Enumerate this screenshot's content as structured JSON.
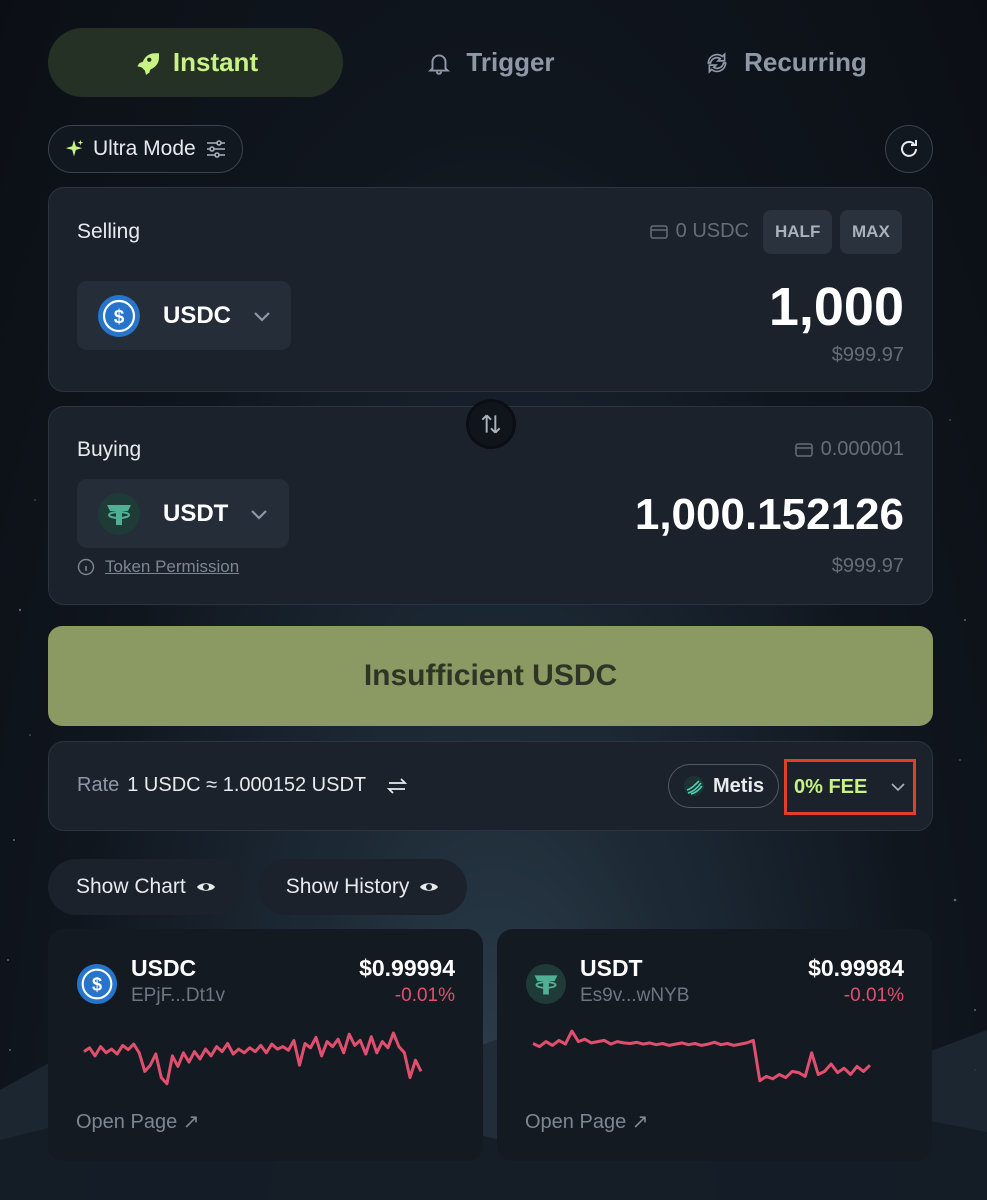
{
  "tabs": [
    {
      "label": "Instant",
      "icon": "rocket-icon",
      "active": true
    },
    {
      "label": "Trigger",
      "icon": "bell-icon",
      "active": false
    },
    {
      "label": "Recurring",
      "icon": "recurring-icon",
      "active": false
    }
  ],
  "mode": {
    "label": "Ultra Mode"
  },
  "selling": {
    "label": "Selling",
    "balance": "0 USDC",
    "half_label": "HALF",
    "max_label": "MAX",
    "token": "USDC",
    "amount": "1,000",
    "usd_value": "$999.97"
  },
  "buying": {
    "label": "Buying",
    "balance": "0.000001",
    "token": "USDT",
    "amount": "1,000.152126",
    "usd_value": "$999.97",
    "permission_label": "Token Permission"
  },
  "cta": {
    "label": "Insufficient USDC"
  },
  "rate": {
    "prefix": "Rate",
    "value": "1 USDC ≈ 1.000152 USDT",
    "router": "Metis",
    "fee": "0% FEE"
  },
  "toggles": {
    "chart": "Show Chart",
    "history": "Show History"
  },
  "cards": [
    {
      "symbol": "USDC",
      "address": "EPjF...Dt1v",
      "price": "$0.99994",
      "change": "-0.01%",
      "open_label": "Open Page ↗",
      "spark": [
        0.62,
        0.68,
        0.55,
        0.7,
        0.6,
        0.66,
        0.58,
        0.72,
        0.65,
        0.74,
        0.6,
        0.3,
        0.4,
        0.58,
        0.2,
        0.1,
        0.55,
        0.38,
        0.6,
        0.45,
        0.62,
        0.5,
        0.66,
        0.55,
        0.7,
        0.62,
        0.75,
        0.58,
        0.66,
        0.6,
        0.68,
        0.62,
        0.72,
        0.6,
        0.74,
        0.66,
        0.7,
        0.64,
        0.8,
        0.4,
        0.75,
        0.68,
        0.85,
        0.55,
        0.78,
        0.7,
        0.82,
        0.6,
        0.9,
        0.72,
        0.8,
        0.58,
        0.86,
        0.6,
        0.78,
        0.68,
        0.92,
        0.7,
        0.6,
        0.2,
        0.48,
        0.3
      ]
    },
    {
      "symbol": "USDT",
      "address": "Es9v...wNYB",
      "price": "$0.99984",
      "change": "-0.01%",
      "open_label": "Open Page ↗",
      "spark": [
        0.75,
        0.7,
        0.78,
        0.72,
        0.8,
        0.74,
        0.95,
        0.78,
        0.82,
        0.76,
        0.78,
        0.8,
        0.74,
        0.78,
        0.76,
        0.75,
        0.77,
        0.74,
        0.76,
        0.73,
        0.75,
        0.72,
        0.74,
        0.76,
        0.73,
        0.75,
        0.72,
        0.74,
        0.77,
        0.73,
        0.75,
        0.72,
        0.74,
        0.76,
        0.8,
        0.15,
        0.22,
        0.18,
        0.25,
        0.2,
        0.3,
        0.28,
        0.22,
        0.6,
        0.25,
        0.3,
        0.42,
        0.28,
        0.35,
        0.25,
        0.38,
        0.3,
        0.4
      ]
    }
  ],
  "colors": {
    "accent": "#c7f284",
    "cta_bg": "#8a9a62",
    "negative": "#e0506e",
    "fee_outline": "#e0402a"
  }
}
